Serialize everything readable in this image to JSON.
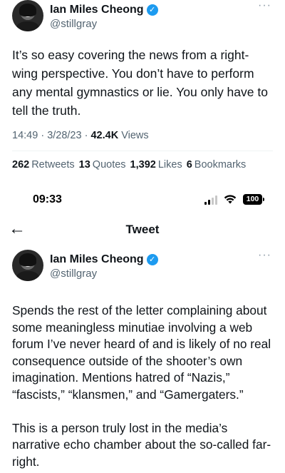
{
  "tweet1": {
    "author": {
      "name": "Ian Miles Cheong",
      "handle": "@stillgray"
    },
    "more_label": "···",
    "text": "It’s so easy covering the news from a right-wing perspective. You don’t have to perform any mental gymnastics or lie. You only have to tell the truth.",
    "time": "14:49",
    "date": "3/28/23",
    "views_count": "42.4K",
    "views_label": "Views",
    "stats": [
      {
        "count": "262",
        "label": "Retweets"
      },
      {
        "count": "13",
        "label": "Quotes"
      },
      {
        "count": "1,392",
        "label": "Likes"
      },
      {
        "count": "6",
        "label": "Bookmarks"
      }
    ]
  },
  "statusbar": {
    "time": "09:33",
    "battery": "100",
    "icons": [
      "signal-icon",
      "wifi-icon",
      "battery-icon"
    ]
  },
  "navbar": {
    "title": "Tweet",
    "back_icon": "arrow-left-icon"
  },
  "tweet2": {
    "author": {
      "name": "Ian Miles Cheong",
      "handle": "@stillgray"
    },
    "more_label": "···",
    "paragraphs": [
      "Spends the rest of the letter complaining about some meaningless minutiae involving a web forum I’ve never heard of and is likely of no real consequence outside of the shooter’s own imagination. Mentions hatred of “Nazis,” “fascists,” “klansmen,” and “Gamergaters.”",
      "This is a person truly lost in the media’s narrative echo chamber about the so-called far-right."
    ]
  },
  "colors": {
    "verified": "#1d9bf0",
    "secondary_text": "#536471",
    "primary_text": "#0f1419"
  }
}
